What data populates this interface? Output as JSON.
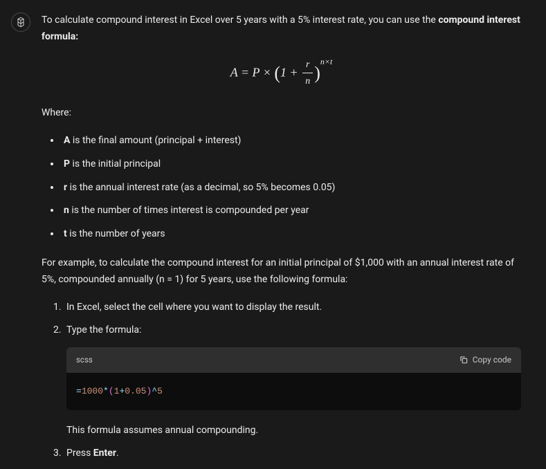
{
  "message": {
    "intro_part1": "To calculate compound interest in Excel over 5 years with a 5% interest rate, you can use the ",
    "intro_bold": "compound interest formula:",
    "formula": {
      "A": "A",
      "eq": " = ",
      "P": "P",
      "times": " × ",
      "lparen": "(",
      "one_plus": "1 + ",
      "num": "r",
      "den": "n",
      "rparen": ")",
      "exp": "n×t"
    },
    "where_label": "Where:",
    "bullets": [
      {
        "sym": "A",
        "desc": " is the final amount (principal + interest)"
      },
      {
        "sym": "P",
        "desc": " is the initial principal"
      },
      {
        "sym": "r",
        "desc": " is the annual interest rate (as a decimal, so 5% becomes 0.05)"
      },
      {
        "sym": "n",
        "desc": " is the number of times interest is compounded per year"
      },
      {
        "sym": "t",
        "desc": " is the number of years"
      }
    ],
    "example_para": "For example, to calculate the compound interest for an initial principal of $1,000 with an annual interest rate of 5%, compounded annually (n = 1) for 5 years, use the following formula:",
    "steps": {
      "s1": "In Excel, select the cell where you want to display the result.",
      "s2": "Type the formula:",
      "after_code": "This formula assumes annual compounding.",
      "s3_pre": "Press ",
      "s3_bold": "Enter",
      "s3_post": "."
    },
    "code": {
      "lang": "scss",
      "copy_label": "Copy code",
      "content": "=1000*(1+0.05)^5"
    }
  }
}
